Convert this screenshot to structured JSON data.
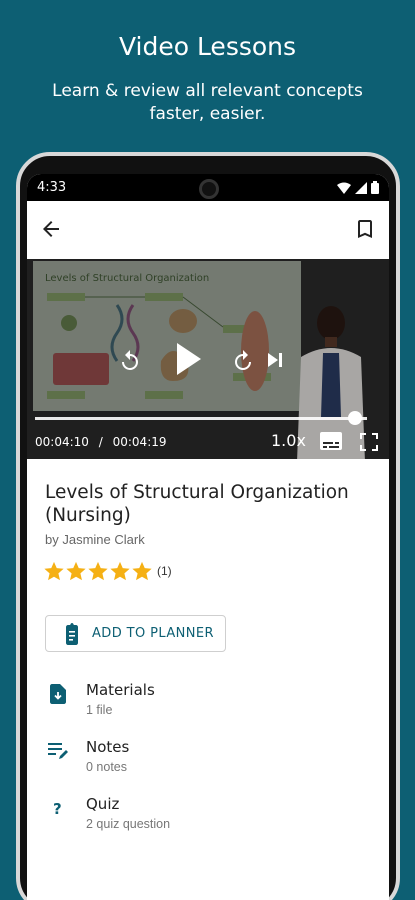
{
  "promo": {
    "title": "Video Lessons",
    "subtitle": "Learn & review all relevant concepts faster, easier."
  },
  "status_bar": {
    "time": "4:33"
  },
  "video": {
    "slide_title": "Levels of Structural Organization",
    "current_time": "00:04:10",
    "separator": "/",
    "duration": "00:04:19",
    "progress": 0.965,
    "speed": "1.0x"
  },
  "lesson": {
    "title": "Levels of Structural Organization (Nursing)",
    "author": "by Jasmine Clark",
    "rating_stars": 5,
    "rating_count": "(1)"
  },
  "actions": {
    "add_to_planner": "ADD TO PLANNER"
  },
  "resources": [
    {
      "title": "Materials",
      "subtitle": "1 file",
      "icon": "file-download-icon"
    },
    {
      "title": "Notes",
      "subtitle": "0 notes",
      "icon": "notes-edit-icon"
    },
    {
      "title": "Quiz",
      "subtitle": "2 quiz question",
      "icon": "question-mark-icon"
    }
  ],
  "colors": {
    "brand": "#0d5f73",
    "star": "#f5b014"
  }
}
